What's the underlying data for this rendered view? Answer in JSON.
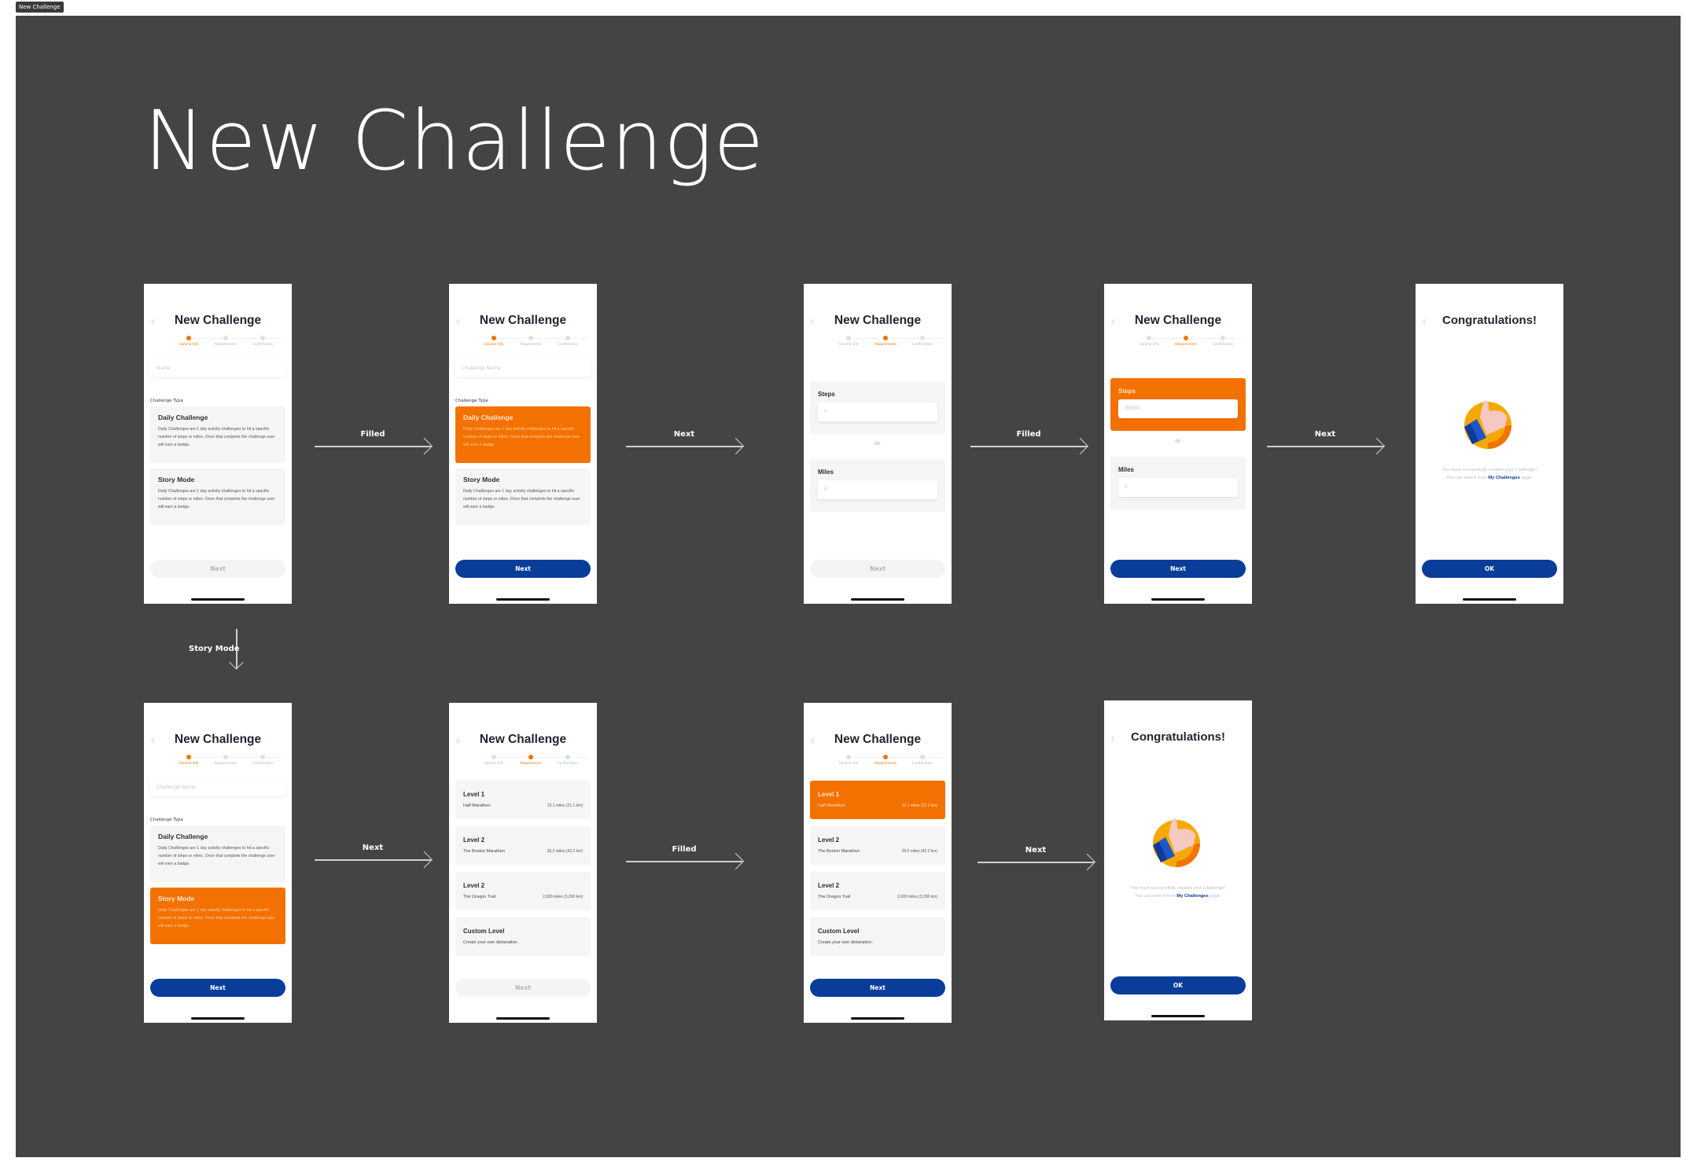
{
  "frame_tag": "New Challenge",
  "board_title": "New Challenge",
  "step_labels": [
    "General Info",
    "Requirements",
    "Confirmation"
  ],
  "colors": {
    "accent_orange": "#f37100",
    "primary_blue": "#0a3d9a",
    "canvas_bg": "#444444"
  },
  "flow_labels": {
    "filled": "Filled",
    "next": "Next",
    "story_mode": "Story Mode"
  },
  "screens": {
    "general_empty": {
      "title": "New Challenge",
      "name_placeholder": "Name",
      "challenge_type_label": "Challenge Type",
      "cards": [
        {
          "title": "Daily Challenge",
          "desc": "Daily Challenges are 1 day activity challenges to hit a specific number of steps or miles. Once that complete the challenge user will earn a badge."
        },
        {
          "title": "Story Mode",
          "desc": "Daily Challenges are 1 day activity challenges to hit a specific number of steps or miles. Once that complete the challenge user will earn a badge."
        }
      ],
      "next_label": "Next"
    },
    "general_daily": {
      "title": "New Challenge",
      "name_placeholder": "Challenge Name",
      "challenge_type_label": "Challenge Type",
      "next_label": "Next"
    },
    "requirements_empty": {
      "title": "New Challenge",
      "steps_label": "Steps",
      "steps_value": "0",
      "or_label": "or",
      "miles_label": "Miles",
      "miles_value": "0",
      "next_label": "Next"
    },
    "requirements_filled": {
      "title": "New Challenge",
      "steps_label": "Steps",
      "steps_value": "35000",
      "or_label": "or",
      "miles_label": "Miles",
      "miles_value": "0",
      "next_label": "Next"
    },
    "congrats": {
      "title": "Congratulations!",
      "message_line1": "You have successfully created your Challenge!",
      "message_line2_pre": "You can view it from ",
      "message_link": "My Challenges",
      "message_line2_post": " page.",
      "ok_label": "OK"
    },
    "levels": [
      {
        "title": "Level 1",
        "name": "Half Marathon",
        "distance": "13.1 miles (21.1 km)"
      },
      {
        "title": "Level 2",
        "name": "The Boston Marathon",
        "distance": "26.2 miles (42.2 km)"
      },
      {
        "title": "Level 2",
        "name": "The Oregon Trail",
        "distance": "2,000 miles (3,200 km)"
      },
      {
        "title": "Custom Level",
        "name": "Create your own distanation.",
        "distance": ""
      }
    ]
  }
}
